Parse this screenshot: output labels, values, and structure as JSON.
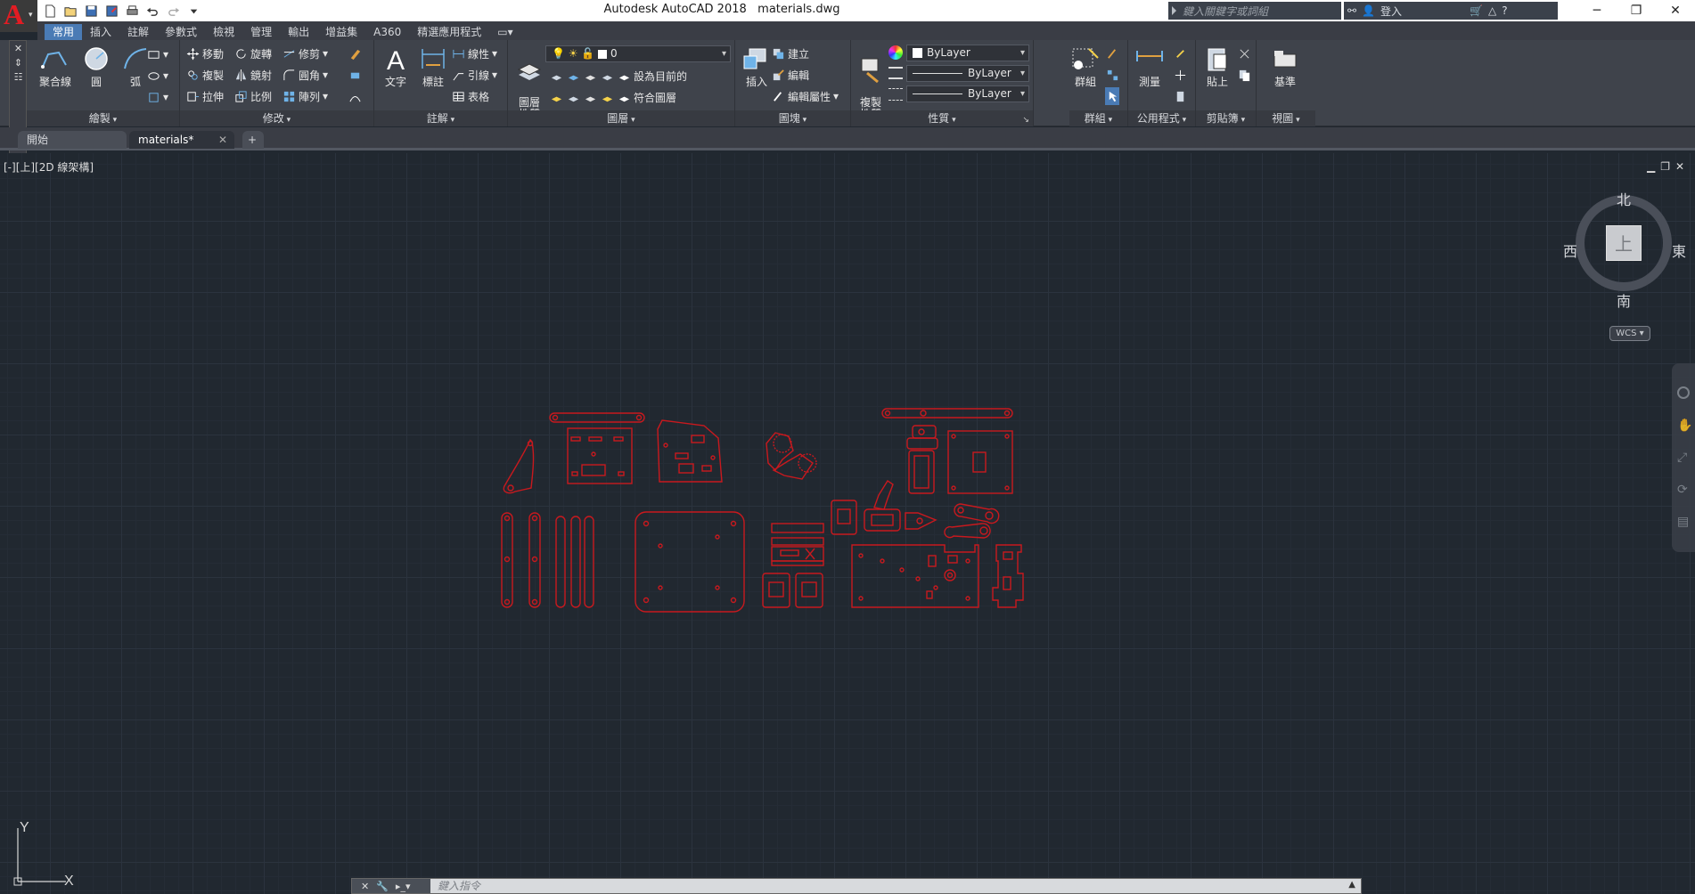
{
  "window": {
    "app_title": "Autodesk AutoCAD 2018",
    "file_name": "materials.dwg",
    "search_placeholder": "鍵入關鍵字或詞組",
    "login_label": "登入"
  },
  "ribbon_tabs": [
    "常用",
    "插入",
    "註解",
    "參數式",
    "檢視",
    "管理",
    "輸出",
    "增益集",
    "A360",
    "精選應用程式"
  ],
  "ribbon_active_tab": "常用",
  "panels": {
    "draw": {
      "title": "繪製",
      "polyline": "聚合線",
      "circle": "圓",
      "arc": "弧"
    },
    "modify": {
      "title": "修改",
      "move": "移動",
      "rotate": "旋轉",
      "trim": "修剪",
      "copy": "複製",
      "mirror": "鏡射",
      "fillet": "圓角",
      "stretch": "拉伸",
      "scale": "比例",
      "array": "陣列"
    },
    "annotation": {
      "title": "註解",
      "text": "文字",
      "dimension": "標註",
      "linear": "線性",
      "leader": "引線",
      "table": "表格"
    },
    "layers": {
      "title": "圖層",
      "layer_properties": "圖層\n性質",
      "current_layer": "0",
      "set_current": "設為目前的",
      "match_layer": "符合圖層"
    },
    "block": {
      "title": "圖塊",
      "insert": "插入",
      "create": "建立",
      "edit": "編輯",
      "edit_attributes": "編輯屬性"
    },
    "properties": {
      "title": "性質",
      "match_properties": "複製\n性質",
      "color": "ByLayer",
      "linetype": "ByLayer",
      "lineweight": "ByLayer"
    },
    "groups": {
      "title": "群組",
      "group": "群組"
    },
    "utilities": {
      "title": "公用程式",
      "measure": "測量"
    },
    "clipboard": {
      "title": "剪貼簿",
      "paste": "貼上"
    },
    "view": {
      "title": "視圖",
      "base": "基準"
    }
  },
  "doc_tabs": [
    {
      "label": "開始",
      "active": false
    },
    {
      "label": "materials*",
      "active": true
    }
  ],
  "viewport": {
    "label": "[-][上][2D 線架構]"
  },
  "viewcube": {
    "north": "北",
    "south": "南",
    "east": "東",
    "west": "西",
    "face": "上",
    "wcs": "WCS"
  },
  "ucs": {
    "x": "X",
    "y": "Y"
  },
  "command_line": {
    "placeholder": "鍵入指令"
  },
  "colors": {
    "drawing_lines": "#c8191e",
    "canvas_bg": "#212830",
    "ribbon_bg": "#3f434b",
    "active_tab": "#4a7bb5"
  }
}
